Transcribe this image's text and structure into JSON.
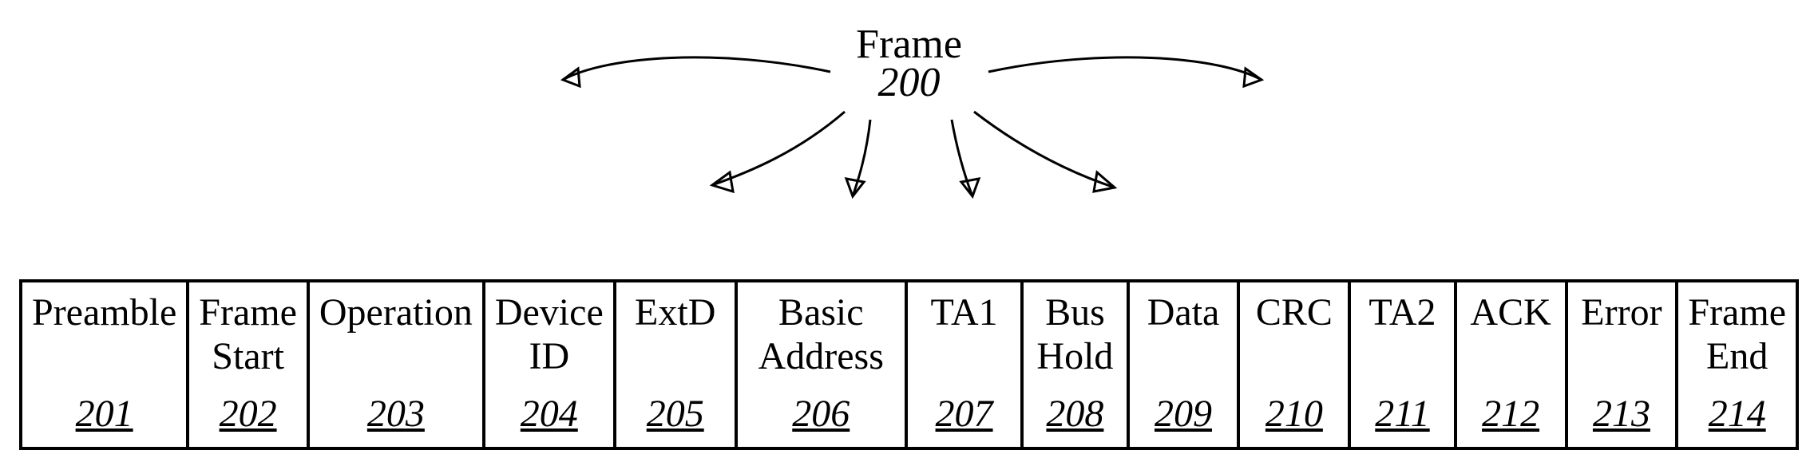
{
  "frame": {
    "label": "Frame",
    "ref": "200"
  },
  "cells": [
    {
      "lines": [
        "Preamble"
      ],
      "ref": "201"
    },
    {
      "lines": [
        "Frame",
        "Start"
      ],
      "ref": "202"
    },
    {
      "lines": [
        "Operation"
      ],
      "ref": "203"
    },
    {
      "lines": [
        "Device",
        "ID"
      ],
      "ref": "204"
    },
    {
      "lines": [
        "ExtD"
      ],
      "ref": "205"
    },
    {
      "lines": [
        "Basic",
        "Address"
      ],
      "ref": "206"
    },
    {
      "lines": [
        "TA1"
      ],
      "ref": "207"
    },
    {
      "lines": [
        "Bus",
        "Hold"
      ],
      "ref": "208"
    },
    {
      "lines": [
        "Data"
      ],
      "ref": "209"
    },
    {
      "lines": [
        "CRC"
      ],
      "ref": "210"
    },
    {
      "lines": [
        "TA2"
      ],
      "ref": "211"
    },
    {
      "lines": [
        "ACK"
      ],
      "ref": "212"
    },
    {
      "lines": [
        "Error"
      ],
      "ref": "213"
    },
    {
      "lines": [
        "Frame",
        "End"
      ],
      "ref": "214"
    }
  ]
}
